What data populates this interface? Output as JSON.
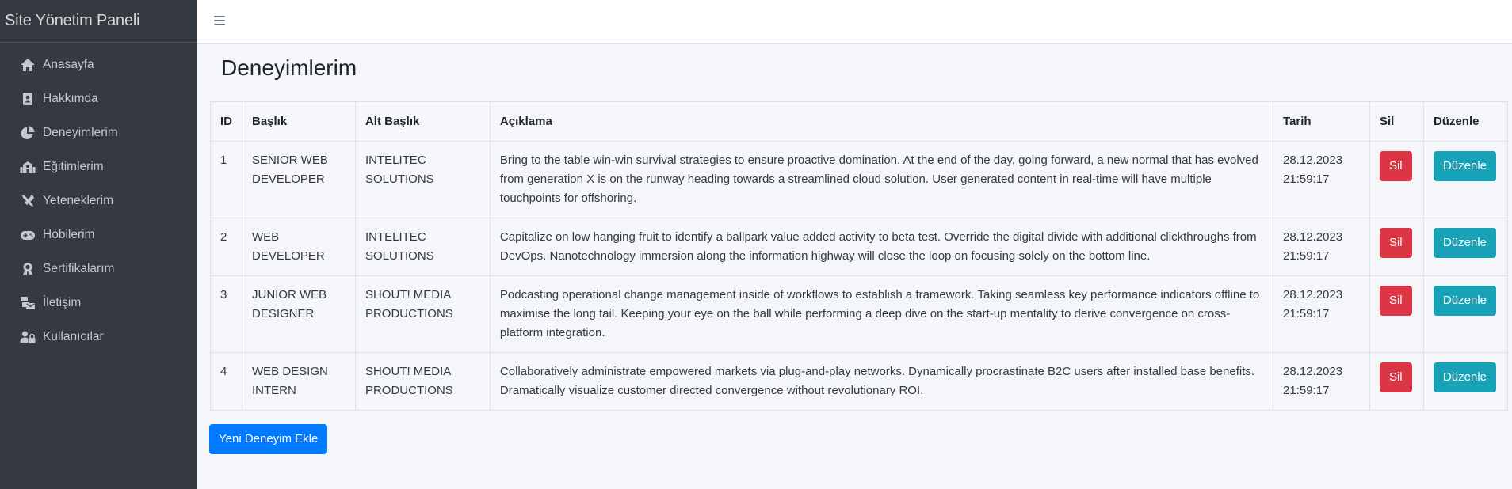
{
  "sidebar": {
    "brand": "Site Yönetim Paneli",
    "items": [
      {
        "label": "Anasayfa",
        "icon": "home-icon"
      },
      {
        "label": "Hakkımda",
        "icon": "address-book-icon"
      },
      {
        "label": "Deneyimlerim",
        "icon": "pie-chart-icon"
      },
      {
        "label": "Eğitimlerim",
        "icon": "school-icon"
      },
      {
        "label": "Yeteneklerim",
        "icon": "tools-icon"
      },
      {
        "label": "Hobilerim",
        "icon": "gamepad-icon"
      },
      {
        "label": "Sertifikalarım",
        "icon": "award-icon"
      },
      {
        "label": "İletişim",
        "icon": "mail-bulk-icon"
      },
      {
        "label": "Kullanıcılar",
        "icon": "users-lock-icon"
      }
    ]
  },
  "page": {
    "title": "Deneyimlerim"
  },
  "table": {
    "headers": [
      "ID",
      "Başlık",
      "Alt Başlık",
      "Açıklama",
      "Tarih",
      "Sil",
      "Düzenle"
    ],
    "rows": [
      {
        "id": "1",
        "title": "SENIOR WEB DEVELOPER",
        "subtitle": "INTELITEC SOLUTIONS",
        "description": "Bring to the table win-win survival strategies to ensure proactive domination. At the end of the day, going forward, a new normal that has evolved from generation X is on the runway heading towards a streamlined cloud solution. User generated content in real-time will have multiple touchpoints for offshoring.",
        "date": "28.12.2023",
        "time": "21:59:17",
        "delete_label": "Sil",
        "edit_label": "Düzenle"
      },
      {
        "id": "2",
        "title": "WEB DEVELOPER",
        "subtitle": "INTELITEC SOLUTIONS",
        "description": "Capitalize on low hanging fruit to identify a ballpark value added activity to beta test. Override the digital divide with additional clickthroughs from DevOps. Nanotechnology immersion along the information highway will close the loop on focusing solely on the bottom line.",
        "date": "28.12.2023",
        "time": "21:59:17",
        "delete_label": "Sil",
        "edit_label": "Düzenle"
      },
      {
        "id": "3",
        "title": "JUNIOR WEB DESIGNER",
        "subtitle": "SHOUT! MEDIA PRODUCTIONS",
        "description": "Podcasting operational change management inside of workflows to establish a framework. Taking seamless key performance indicators offline to maximise the long tail. Keeping your eye on the ball while performing a deep dive on the start-up mentality to derive convergence on cross-platform integration.",
        "date": "28.12.2023",
        "time": "21:59:17",
        "delete_label": "Sil",
        "edit_label": "Düzenle"
      },
      {
        "id": "4",
        "title": "WEB DESIGN INTERN",
        "subtitle": "SHOUT! MEDIA PRODUCTIONS",
        "description": "Collaboratively administrate empowered markets via plug-and-play networks. Dynamically procrastinate B2C users after installed base benefits. Dramatically visualize customer directed convergence without revolutionary ROI.",
        "date": "28.12.2023",
        "time": "21:59:17",
        "delete_label": "Sil",
        "edit_label": "Düzenle"
      }
    ]
  },
  "actions": {
    "add_label": "Yeni Deneyim Ekle"
  },
  "colors": {
    "sidebar_bg": "#343a40",
    "danger": "#dc3545",
    "info": "#17a2b8",
    "primary": "#007bff",
    "content_bg": "#f4f6f9"
  }
}
